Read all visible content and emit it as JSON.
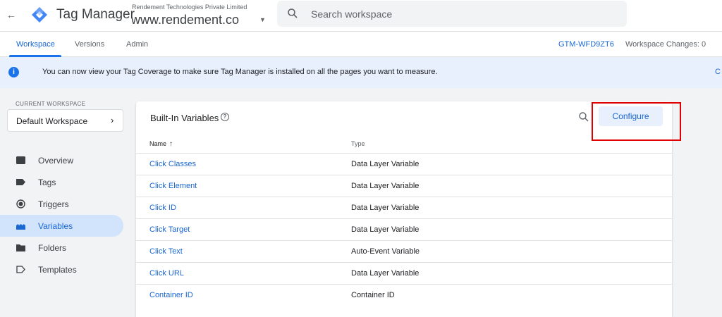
{
  "header": {
    "back_icon": "back-arrow-icon",
    "app_title": "Tag Manager",
    "account_name": "Rendement Technologies Private Limited",
    "container_name": "www.rendement.co",
    "search_placeholder": "Search workspace"
  },
  "tabs": {
    "items": [
      {
        "label": "Workspace",
        "active": true
      },
      {
        "label": "Versions",
        "active": false
      },
      {
        "label": "Admin",
        "active": false
      }
    ],
    "container_id": "GTM-WFD9ZT6",
    "workspace_changes": "Workspace Changes: 0"
  },
  "banner": {
    "text": "You can now view your Tag Coverage to make sure Tag Manager is installed on all the pages you want to measure.",
    "edge_text": "C"
  },
  "sidebar": {
    "current_workspace_label": "CURRENT WORKSPACE",
    "workspace_name": "Default Workspace",
    "items": [
      {
        "label": "Overview",
        "icon": "overview-icon",
        "active": false
      },
      {
        "label": "Tags",
        "icon": "tag-icon",
        "active": false
      },
      {
        "label": "Triggers",
        "icon": "trigger-icon",
        "active": false
      },
      {
        "label": "Variables",
        "icon": "variables-icon",
        "active": true
      },
      {
        "label": "Folders",
        "icon": "folder-icon",
        "active": false
      },
      {
        "label": "Templates",
        "icon": "templates-icon",
        "active": false
      }
    ]
  },
  "card": {
    "title": "Built-In Variables",
    "configure_label": "Configure",
    "columns": {
      "name": "Name",
      "type": "Type"
    },
    "rows": [
      {
        "name": "Click Classes",
        "type": "Data Layer Variable"
      },
      {
        "name": "Click Element",
        "type": "Data Layer Variable"
      },
      {
        "name": "Click ID",
        "type": "Data Layer Variable"
      },
      {
        "name": "Click Target",
        "type": "Data Layer Variable"
      },
      {
        "name": "Click Text",
        "type": "Auto-Event Variable"
      },
      {
        "name": "Click URL",
        "type": "Data Layer Variable"
      },
      {
        "name": "Container ID",
        "type": "Container ID"
      }
    ]
  },
  "colors": {
    "accent": "#1a73e8",
    "link": "#1967d2",
    "banner_bg": "#e8f0fe",
    "highlight": "#e00000"
  }
}
